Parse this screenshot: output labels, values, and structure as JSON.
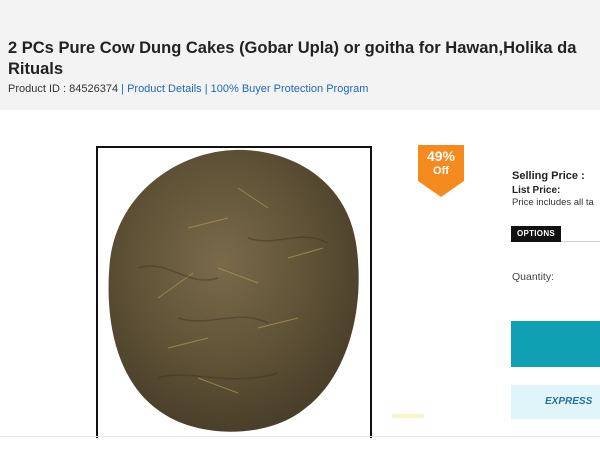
{
  "product": {
    "title_line1": "2 PCs Pure Cow Dung Cakes (Gobar Upla) or goitha for Hawan,Holika da",
    "title_line2": "Rituals",
    "id_text": "Product ID : 84526374",
    "separator": "|",
    "details_link": "Product Details",
    "protection_link": "100% Buyer Protection Program"
  },
  "discount": {
    "percent": "49%",
    "off": "Off",
    "color": "#f58a1f"
  },
  "pricing": {
    "selling_label": "Selling Price :",
    "list_label": "List Price:",
    "tax_note": "Price includes all ta"
  },
  "options": {
    "label": "OPTIONS"
  },
  "quantity": {
    "label": "Quantity:"
  },
  "buy_button": {
    "color": "#0fa0b3"
  },
  "express": {
    "label": "EXPRESS"
  },
  "image": {
    "alt_icon": "cow-dung-cake-image"
  }
}
